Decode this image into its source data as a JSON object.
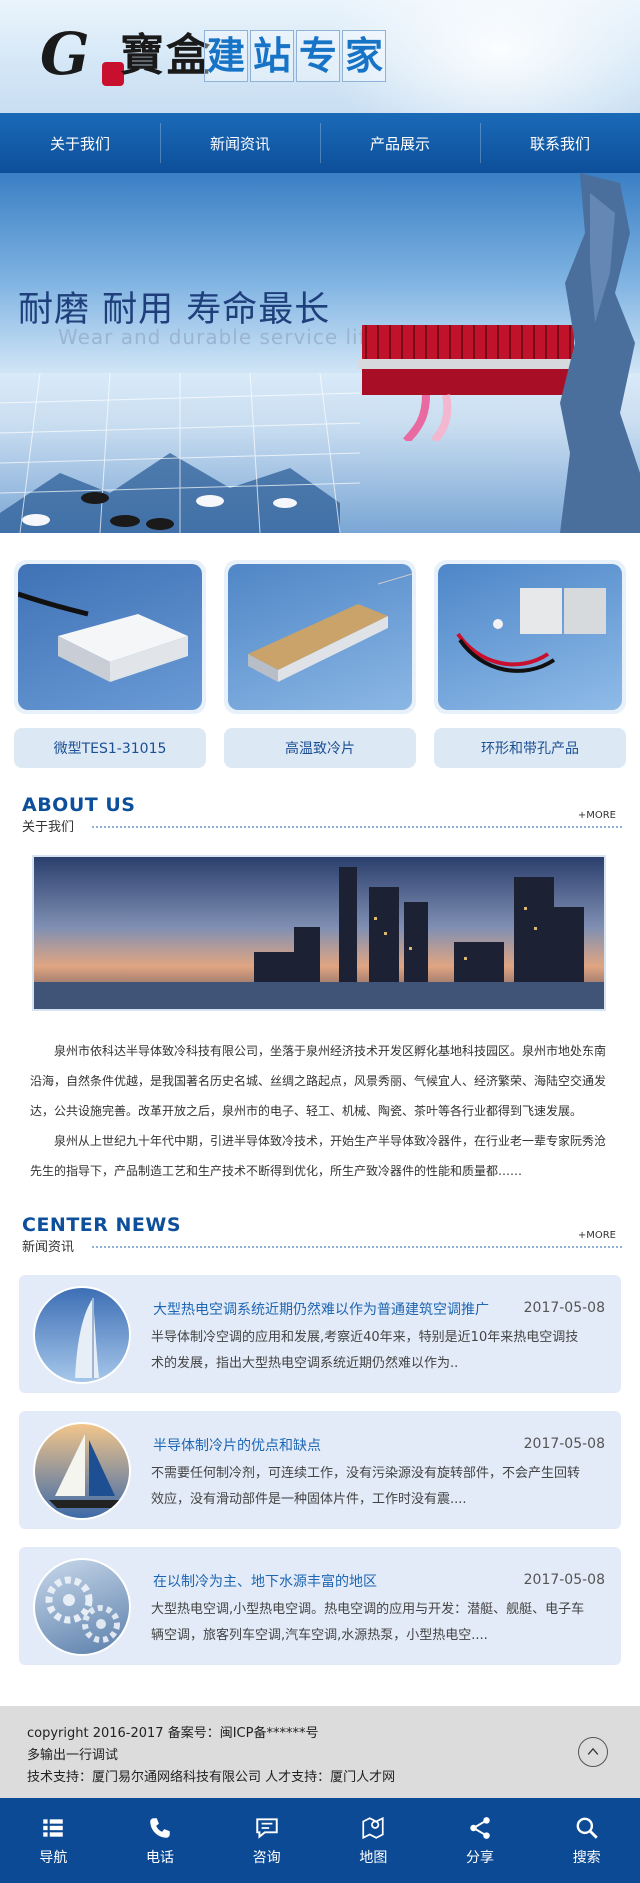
{
  "header": {
    "logo_brand": "寶盒",
    "slogan": [
      "建",
      "站",
      "专",
      "家"
    ]
  },
  "nav": {
    "items": [
      "关于我们",
      "新闻资讯",
      "产品展示",
      "联系我们"
    ]
  },
  "banner": {
    "headline": "耐磨 耐用 寿命最长",
    "subline": "Wear and durable service life"
  },
  "products": [
    {
      "label": "微型TES1-31015"
    },
    {
      "label": "高温致冷片"
    },
    {
      "label": "环形和带孔产品"
    }
  ],
  "about": {
    "en": "ABOUT US",
    "cn": "关于我们",
    "more": "+MORE",
    "para1": "泉州市依科达半导体致冷科技有限公司，坐落于泉州经济技术开发区孵化基地科技园区。泉州市地处东南沿海，自然条件优越，是我国著名历史名城、丝绸之路起点，风景秀丽、气候宜人、经济繁荣、海陆空交通发达，公共设施完善。改革开放之后，泉州市的电子、轻工、机械、陶瓷、茶叶等各行业都得到飞速发展。",
    "para2": "泉州从上世纪九十年代中期，引进半导体致冷技术，开始生产半导体致冷器件，在行业老一辈专家阮秀沧先生的指导下，产品制造工艺和生产技术不断得到优化，所生产致冷器件的性能和质量都……"
  },
  "news": {
    "en": "CENTER NEWS",
    "cn": "新闻资讯",
    "more": "+MORE",
    "items": [
      {
        "title": "大型热电空调系统近期仍然难以作为普通建筑空调推广",
        "date": "2017-05-08",
        "summary": "半导体制冷空调的应用和发展,考察近40年来，特别是近10年来热电空调技术的发展，指出大型热电空调系统近期仍然难以作为.."
      },
      {
        "title": "半导体制冷片的优点和缺点",
        "date": "2017-05-08",
        "summary": "不需要任何制冷剂，可连续工作，没有污染源没有旋转部件，不会产生回转效应，没有滑动部件是一种固体片件，工作时没有震...."
      },
      {
        "title": "在以制冷为主、地下水源丰富的地区",
        "date": "2017-05-08",
        "summary": "大型热电空调,小型热电空调。热电空调的应用与开发：潜艇、舰艇、电子车辆空调，旅客列车空调,汽车空调,水源热泵，小型热电空...."
      }
    ]
  },
  "footer": {
    "line1": "copyright 2016-2017 备案号：闽ICP备******号",
    "line2": "多输出一行调试",
    "line3": "技术支持：厦门易尔通网络科技有限公司 人才支持：厦门人才网"
  },
  "tabbar": {
    "items": [
      {
        "label": "导航",
        "icon": "menu-icon"
      },
      {
        "label": "电话",
        "icon": "phone-icon"
      },
      {
        "label": "咨询",
        "icon": "chat-icon"
      },
      {
        "label": "地图",
        "icon": "map-icon"
      },
      {
        "label": "分享",
        "icon": "share-icon"
      },
      {
        "label": "搜索",
        "icon": "search-icon"
      }
    ]
  },
  "colors": {
    "brand_blue": "#0d4f9a",
    "tabbar_blue": "#0d4a95",
    "card_bg": "#e2ebf7"
  }
}
